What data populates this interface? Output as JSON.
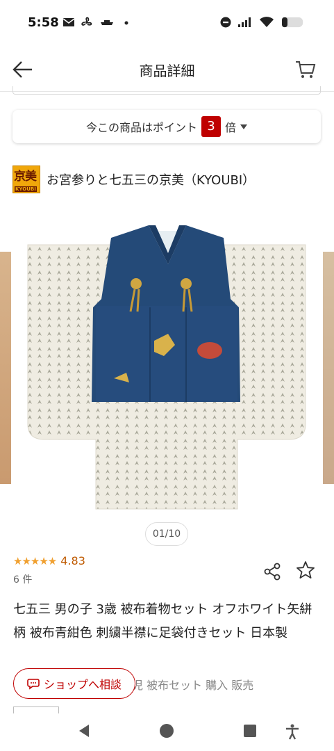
{
  "status_bar": {
    "time": "5:58",
    "icons": [
      "mail-icon",
      "fan-icon",
      "boat-icon",
      "dot-icon",
      "do-not-disturb-icon",
      "signal-icon",
      "wifi-icon",
      "battery-icon"
    ]
  },
  "header": {
    "title": "商品詳細",
    "back_icon": "arrow-left-icon",
    "cart_icon": "cart-icon"
  },
  "points_banner": {
    "prefix": "今この商品はポイント",
    "multiplier": "3",
    "suffix": "倍",
    "accent_color": "#bf0000"
  },
  "shop": {
    "logo_text": "京美",
    "logo_sub": "KYOUBI",
    "name": "お宮参りと七五三の京美（KYOUBI）"
  },
  "carousel": {
    "counter": "01/10"
  },
  "rating": {
    "stars": "★★★★★",
    "value": "4.83",
    "count": "6 件"
  },
  "product": {
    "title": "七五三 男の子 3歳 被布着物セット オフホワイト矢絣柄 被布青紺色 刺繍半襟に足袋付きセット 日本製",
    "tag_line": "児 被布セット 購入 販売"
  },
  "actions": {
    "consult_label": "ショップへ相談",
    "share_icon": "share-icon",
    "favorite_icon": "star-outline-icon"
  },
  "nav_bar": {
    "icons": [
      "back-triangle-icon",
      "home-circle-icon",
      "recents-square-icon",
      "accessibility-icon"
    ]
  }
}
